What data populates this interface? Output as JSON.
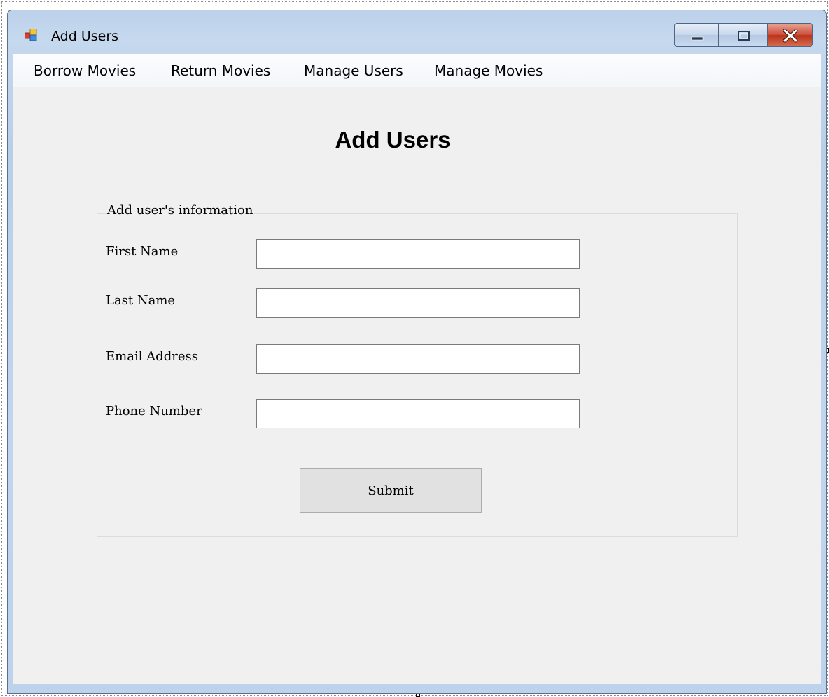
{
  "window": {
    "title": "Add Users",
    "controls": {
      "minimize_icon": "minimize-icon",
      "maximize_icon": "maximize-icon",
      "close_icon": "close-icon"
    }
  },
  "menu": {
    "items": [
      {
        "label": "Borrow Movies"
      },
      {
        "label": "Return Movies"
      },
      {
        "label": "Manage Users"
      },
      {
        "label": "Manage Movies"
      }
    ]
  },
  "page": {
    "heading": "Add Users"
  },
  "form": {
    "group_title": "Add user's information",
    "fields": [
      {
        "label": "First Name",
        "value": ""
      },
      {
        "label": "Last Name",
        "value": ""
      },
      {
        "label": "Email Address",
        "value": ""
      },
      {
        "label": "Phone Number",
        "value": ""
      }
    ],
    "submit_label": "Submit"
  },
  "colors": {
    "window_frame": "#bcd2ea",
    "client_background": "#f0f0f0",
    "close_button": "#c9452e"
  }
}
